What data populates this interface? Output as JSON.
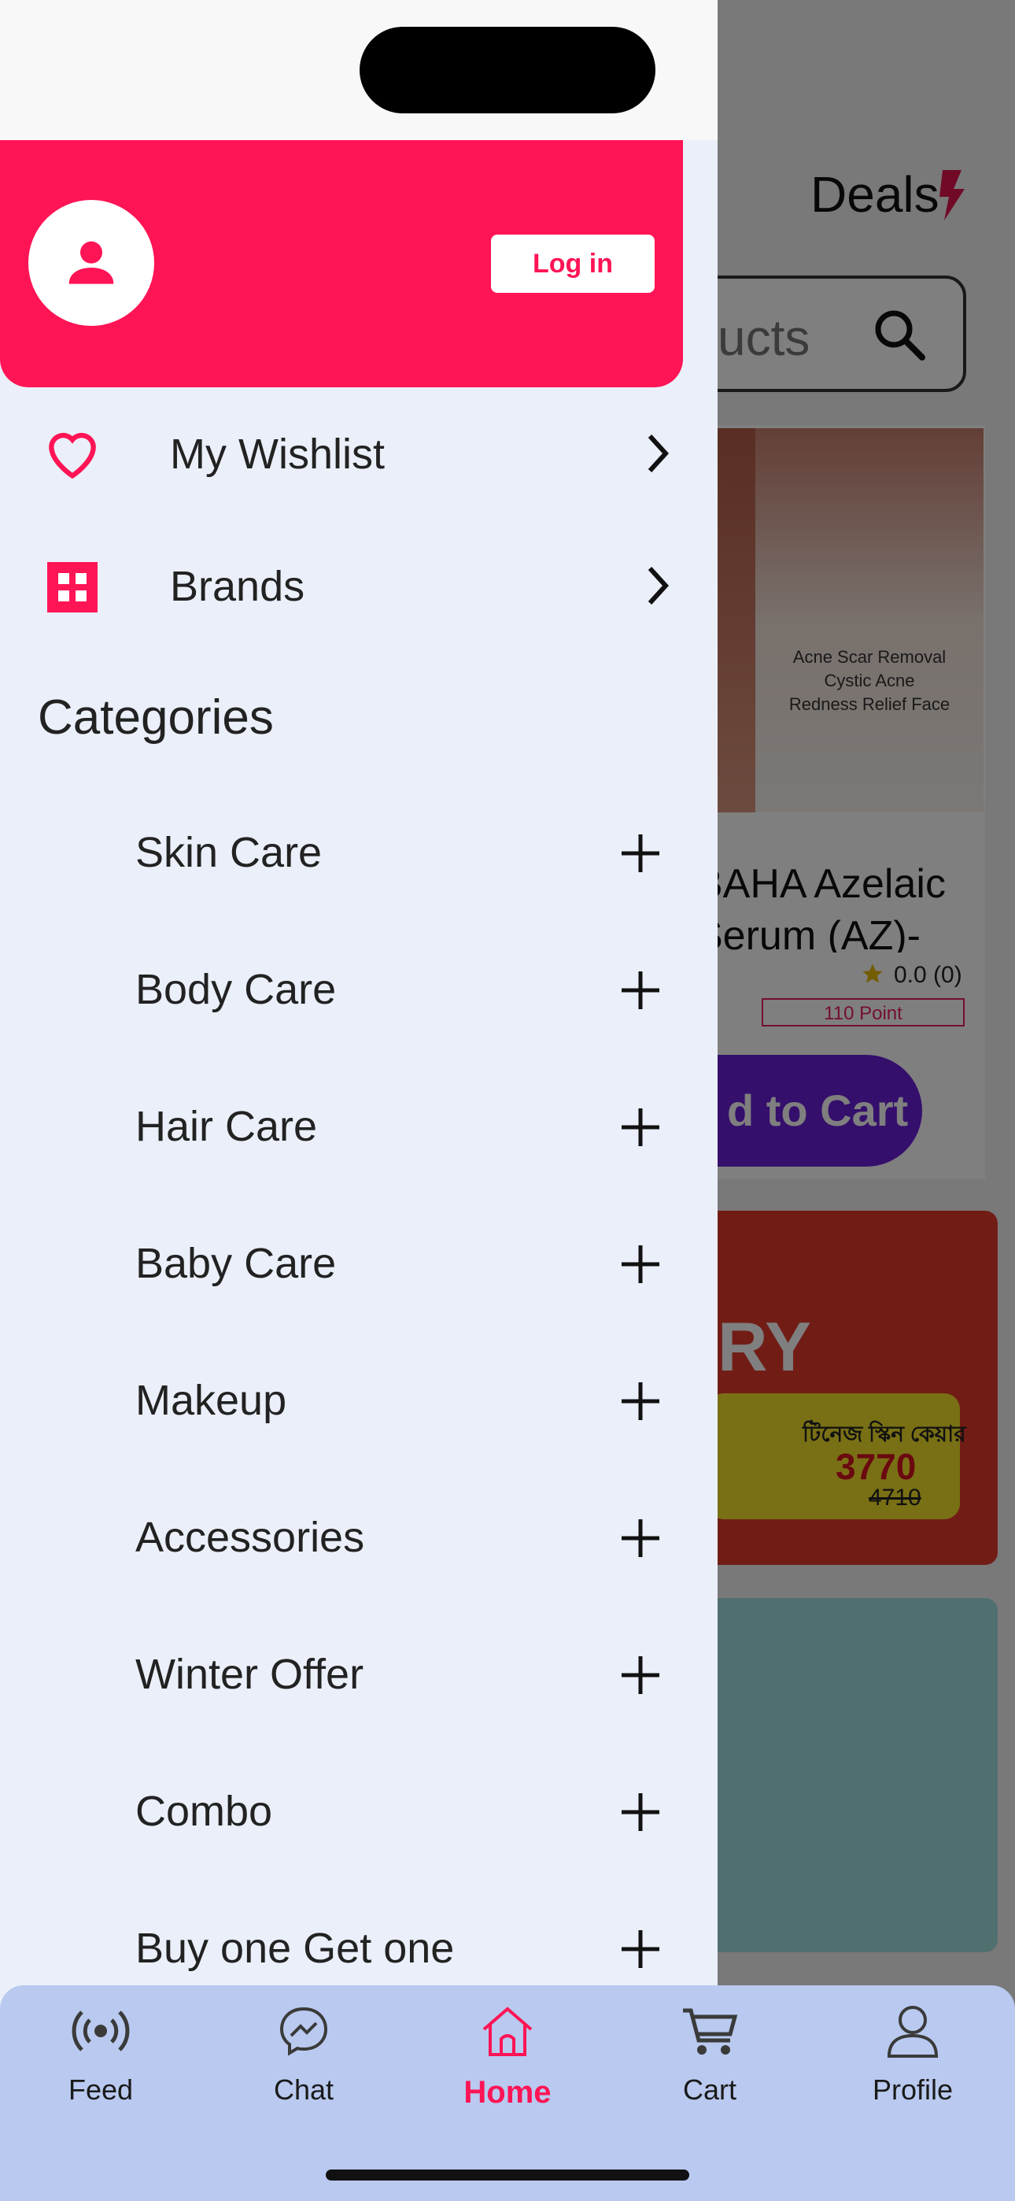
{
  "background": {
    "header_title": "Deals",
    "search_placeholder_fragment": "ucts",
    "product": {
      "image_text": "Acne Scar Removal\nCystic Acne\nRedness Relief Face",
      "name_fragment": "BAHA Azelaic Serum (AZ)-",
      "rating": "0.0 (0)",
      "points": "110 Point",
      "add_to_cart_fragment": "d to Cart"
    },
    "banner": {
      "headline_fragment": "RY",
      "bn_text": "টিনেজ স্কিন কেয়ার",
      "price": "3770",
      "old_price": "4710"
    }
  },
  "drawer": {
    "login_label": "Log in",
    "menu": [
      {
        "label": "My Wishlist",
        "icon": "heart-icon"
      },
      {
        "label": "Brands",
        "icon": "grid-icon"
      }
    ],
    "categories_title": "Categories",
    "categories": [
      {
        "label": "Skin Care"
      },
      {
        "label": "Body Care"
      },
      {
        "label": "Hair Care"
      },
      {
        "label": "Baby Care"
      },
      {
        "label": "Makeup"
      },
      {
        "label": "Accessories"
      },
      {
        "label": "Winter Offer"
      },
      {
        "label": "Combo"
      },
      {
        "label": "Buy one Get one"
      }
    ]
  },
  "bottom_nav": {
    "items": [
      {
        "label": "Feed",
        "icon": "feed-broadcast-icon"
      },
      {
        "label": "Chat",
        "icon": "messenger-icon"
      },
      {
        "label": "Home",
        "icon": "home-icon",
        "active": true
      },
      {
        "label": "Cart",
        "icon": "cart-icon"
      },
      {
        "label": "Profile",
        "icon": "profile-icon"
      }
    ]
  },
  "colors": {
    "accent": "#ff1455",
    "drawer_bg": "#eaeff9",
    "nav_bg": "#b9c9ef"
  }
}
